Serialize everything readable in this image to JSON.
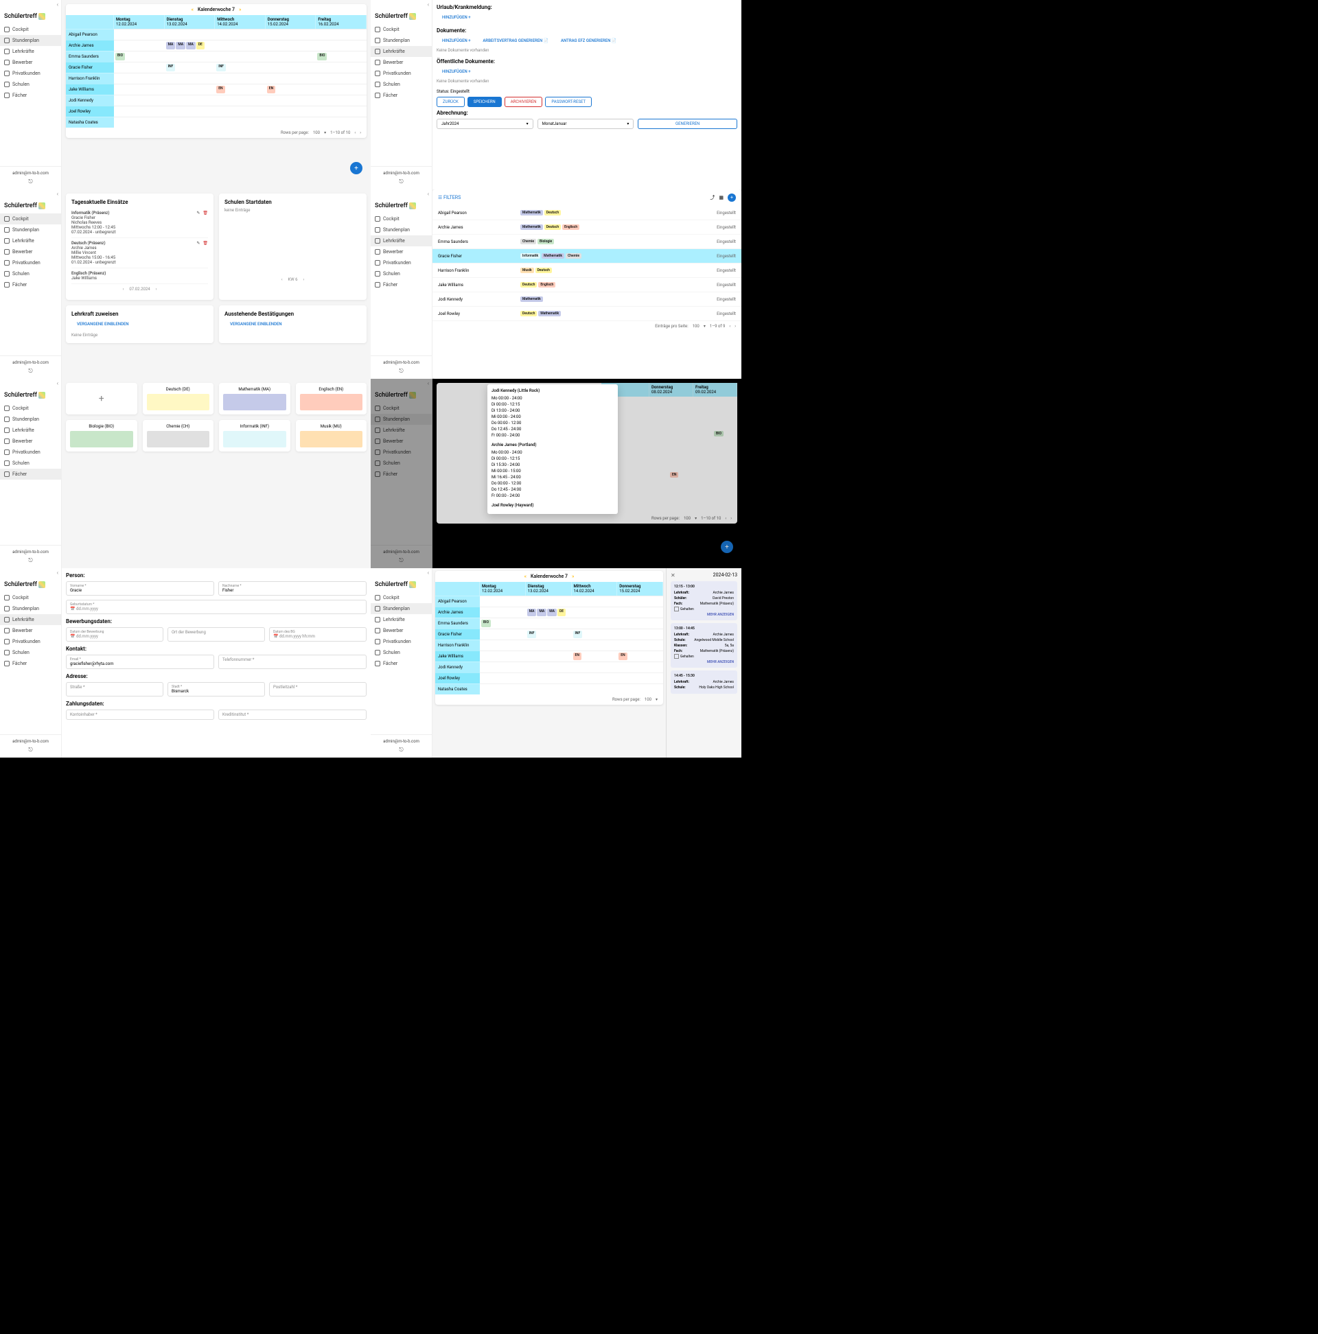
{
  "brand": "Schülertreff",
  "nav": {
    "cockpit": "Cockpit",
    "stundenplan": "Stundenplan",
    "lehrkraefte": "Lehrkräfte",
    "bewerber": "Bewerber",
    "privatkunden": "Privatkunden",
    "schulen": "Schulen",
    "faecher": "Fächer"
  },
  "footer": {
    "email": "admin@m-to-b.com"
  },
  "week": {
    "label": "Kalenderwoche 7",
    "days": [
      {
        "name": "Montag",
        "date": "12.02.2024"
      },
      {
        "name": "Dienstag",
        "date": "13.02.2024"
      },
      {
        "name": "Mittwoch",
        "date": "14.02.2024"
      },
      {
        "name": "Donnerstag",
        "date": "15.02.2024"
      },
      {
        "name": "Freitag",
        "date": "16.02.2024"
      }
    ]
  },
  "teachers": [
    "Abigail Pearson",
    "Archie James",
    "Emma Saunders",
    "Gracie Fisher",
    "Harrison Franklin",
    "Jake Williams",
    "Jodi Kennedy",
    "Joel Rowley",
    "Natasha Coates"
  ],
  "pager": {
    "rpp_label": "Rows per page:",
    "rpp_val": "100",
    "range": "1–10 of 10"
  },
  "p2": {
    "urlaub": "Urlaub/Krankmeldung:",
    "hinzufuegen": "HINZUFÜGEN",
    "dokumente": "Dokumente:",
    "av": "ARBEITSVERTRAG GENERIEREN",
    "efz": "ANTRAG EFZ GENERIEREN",
    "none": "Keine Dokumente vorhanden",
    "pubdoc": "Öffentliche Dokumente:",
    "status_l": "Status: Eingestellt",
    "zurueck": "ZURÜCK",
    "speichern": "SPEICHERN",
    "archivieren": "ARCHIVIEREN",
    "pwreset": "PASSWORT-RESET",
    "abrechnung": "Abrechnung:",
    "jahr_l": "Jahr",
    "jahr_v": "2024",
    "monat_l": "Monat",
    "monat_v": "Januar",
    "generieren": "GENERIEREN"
  },
  "p3": {
    "t1": "Tagesaktuelle Einsätze",
    "t2": "Schulen Startdaten",
    "t3": "Lehrkraft zuweisen",
    "t4": "Ausstehende Bestätigungen",
    "keine": "keine Einträge",
    "vergangene": "VERGANGENE EINBLENDEN",
    "none2": "Keine Einträge",
    "date": "07.02.2024",
    "kw": "KW 6",
    "e1": {
      "h": "Informatik (Präsenz)",
      "n1": "Gracie Fisher",
      "n2": "Nicholas Reeves",
      "t": "Mittwochs 12:00 - 12:45",
      "d": "07.02.2024 - unbegrenzt"
    },
    "e2": {
      "h": "Deutsch (Präsenz)",
      "n1": "Archie James",
      "n2": "Millie Vincent",
      "t": "Mittwochs 15:00 - 16:45",
      "d": "01.02.2024 - unbegrenzt"
    },
    "e3": {
      "h": "Englisch (Präsenz)",
      "n1": "Jake Williams"
    }
  },
  "p4": {
    "filters": "FILTERS",
    "status": "Eingestellt",
    "rpp_l": "Einträge pro Seite:",
    "rpp_v": "100",
    "range": "1–9 of 9",
    "rows": [
      {
        "n": "Abigail Pearson",
        "t": [
          "Mathematik",
          "Deutsch"
        ]
      },
      {
        "n": "Archie James",
        "t": [
          "Mathematik",
          "Deutsch",
          "Englisch"
        ]
      },
      {
        "n": "Emma Saunders",
        "t": [
          "Chemie",
          "Biologie"
        ]
      },
      {
        "n": "Gracie Fisher",
        "t": [
          "Informatik",
          "Mathematik",
          "Chemie"
        ]
      },
      {
        "n": "Harrison Franklin",
        "t": [
          "Musik",
          "Deutsch"
        ]
      },
      {
        "n": "Jake Williams",
        "t": [
          "Deutsch",
          "Englisch"
        ]
      },
      {
        "n": "Jodi Kennedy",
        "t": [
          "Mathematik"
        ]
      },
      {
        "n": "Joel Rowley",
        "t": [
          "Deutsch",
          "Mathematik"
        ]
      }
    ]
  },
  "p5": {
    "subjects": [
      {
        "n": "Deutsch (DE)",
        "c": "#fff8c4"
      },
      {
        "n": "Mathematik (MA)",
        "c": "#c5cae9"
      },
      {
        "n": "Englisch (EN)",
        "c": "#ffccbc"
      },
      {
        "n": "Biologie (BIO)",
        "c": "#c8e6c9"
      },
      {
        "n": "Chemie (CH)",
        "c": "#e0e0e0"
      },
      {
        "n": "Informatik (INF)",
        "c": "#e0f7fa"
      },
      {
        "n": "Musik (MU)",
        "c": "#ffe0b2"
      }
    ]
  },
  "p6": {
    "t1": "Jodi Kennedy (Little Rock)",
    "t2": "Archie James (Portland)",
    "t3": "Joel Rowley (Hayward)",
    "s1": [
      "Mo 00:00 - 24:00",
      "Di 00:00 - 12:15",
      "Di 13:00 - 24:00",
      "Mi 00:00 - 24:00",
      "Do 00:00 - 12:00",
      "Do 12:45 - 24:00",
      "Fr 00:00 - 24:00"
    ],
    "s2": [
      "Mo 00:00 - 24:00",
      "Di 00:00 - 12:15",
      "Di 15:30 - 24:00",
      "Mi 00:00 - 15:00",
      "Mi 16:45 - 24:00",
      "Do 00:00 - 12:00",
      "Do 12:45 - 24:00",
      "Fr 00:00 - 24:00"
    ],
    "days": [
      {
        "n": "Donnerstag",
        "d": "08.02.2024"
      },
      {
        "n": "Freitag",
        "d": "09.02.2024"
      }
    ]
  },
  "p7": {
    "person": "Person:",
    "bewerbung": "Bewerbungsdaten:",
    "kontakt": "Kontakt:",
    "adresse": "Adresse:",
    "zahlung": "Zahlungsdaten:",
    "vorname_l": "Vorname *",
    "vorname_v": "Gracie",
    "nachname_l": "Nachname *",
    "nachname_v": "Fisher",
    "geb_l": "Geburtsdatum *",
    "geb_ph": "dd.mm.yyyy",
    "bew_l": "Datum der Bewerbung",
    "bew_ph": "dd.mm.yyyy",
    "ort_ph": "Ort der Bewerbung",
    "bg_l": "Datum des BG",
    "bg_ph": "dd.mm.yyyy hh:mm",
    "email_l": "Email *",
    "email_v": "graciefisher@rhyta.com",
    "tel_ph": "Telefonnummer *",
    "strasse_ph": "Straße *",
    "stadt_l": "Stadt *",
    "stadt_v": "Bismarck",
    "plz_ph": "Postleitzahl *",
    "konto_ph": "Kontoinhaber *",
    "kredit_ph": "Kreditinstitut *"
  },
  "p8": {
    "date": "2024-02-13",
    "days": [
      {
        "n": "Montag",
        "d": "12.02.2024"
      },
      {
        "n": "Dienstag",
        "d": "13.02.2024"
      },
      {
        "n": "Mittwoch",
        "d": "14.02.2024"
      },
      {
        "n": "Donnerstag",
        "d": "15.02.2024"
      }
    ],
    "c1": {
      "time": "12:15 - 13:00",
      "lk_l": "Lehrkraft:",
      "lk_v": "Archie James",
      "sch_l": "Schüler:",
      "sch_v": "David Preston",
      "fach_l": "Fach:",
      "fach_v": "Mathematik (Präsenz)",
      "geh": "Gehalten",
      "more": "MEHR ANZEIGEN"
    },
    "c2": {
      "time": "13:00 - 14:45",
      "lk_l": "Lehrkraft:",
      "lk_v": "Archie James",
      "sch_l": "Schule:",
      "sch_v": "Angelwood Middle School",
      "kl_l": "Klassen:",
      "kl_v": "5a, 5a",
      "fach_l": "Fach:",
      "fach_v": "Mathematik (Präsenz)",
      "geh": "Gehalten",
      "more": "MEHR ANZEIGEN"
    },
    "c3": {
      "time": "14:45 - 15:30",
      "lk_l": "Lehrkraft:",
      "lk_v": "Archie James",
      "sch_l": "Schule:",
      "sch_v": "Holy Oaks High School"
    }
  }
}
